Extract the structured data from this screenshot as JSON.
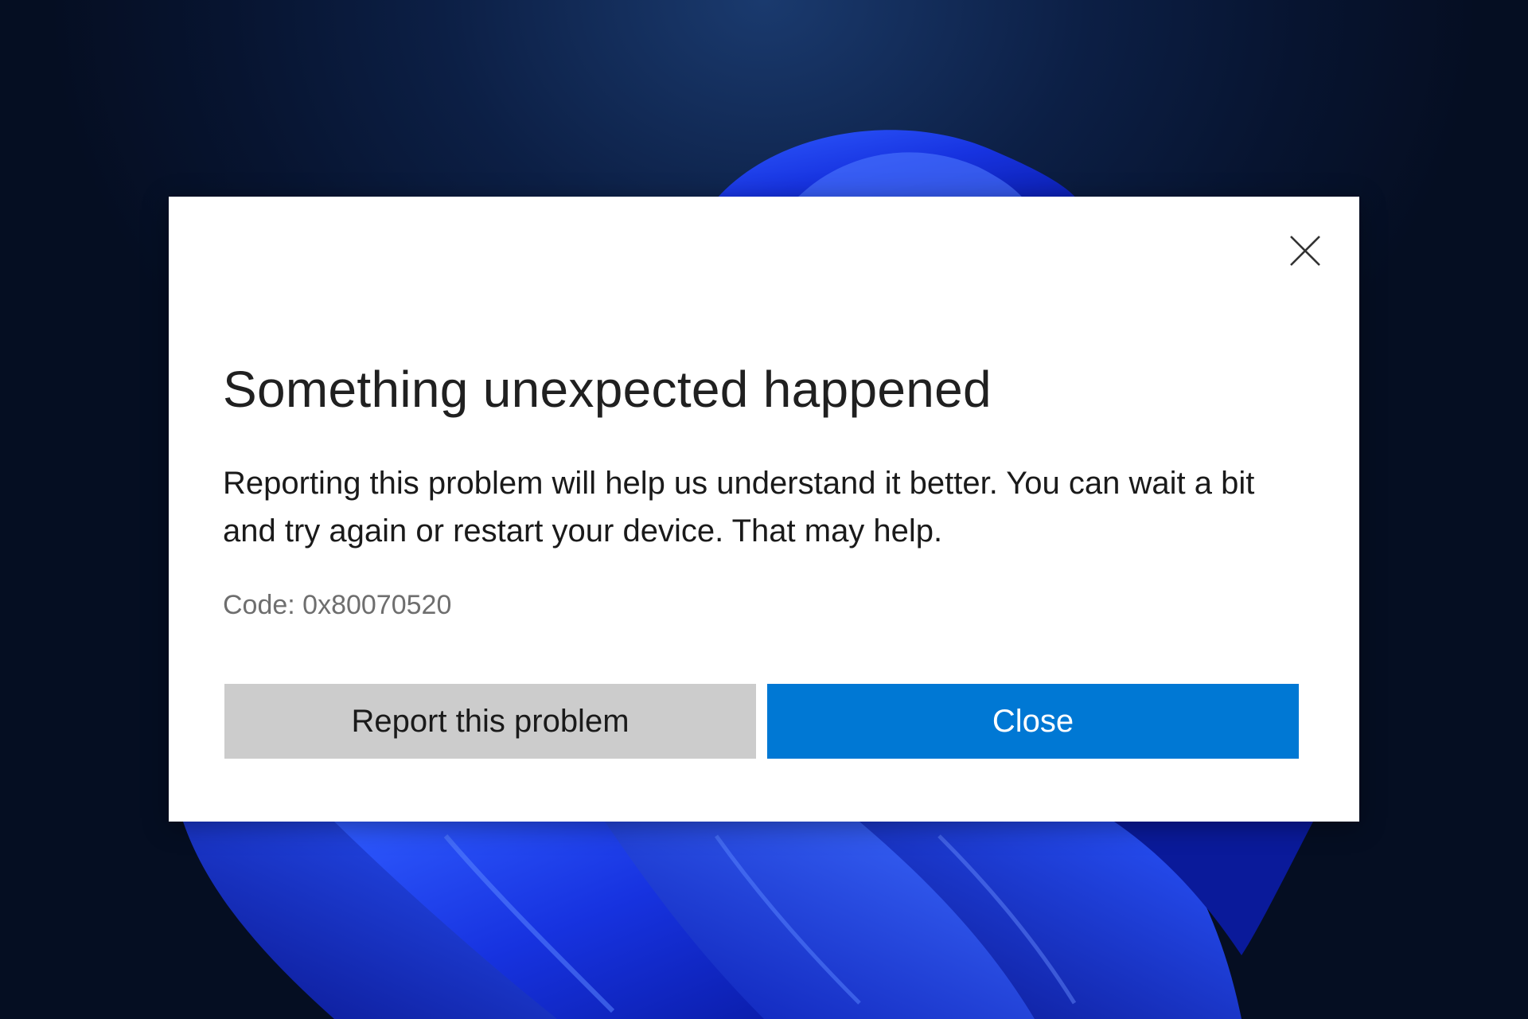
{
  "dialog": {
    "title": "Something unexpected happened",
    "message": "Reporting this problem will help us understand it better. You can wait a bit and try again or restart your device. That may help.",
    "code": "Code: 0x80070520",
    "close_icon": "close-icon",
    "buttons": {
      "report_label": "Report this problem",
      "close_label": "Close"
    }
  },
  "colors": {
    "accent_button": "#0078d4",
    "secondary_button": "#cccccc",
    "dialog_background": "#ffffff",
    "desktop_background": "#071430",
    "wallpaper_bloom": "#1a3cf0"
  }
}
